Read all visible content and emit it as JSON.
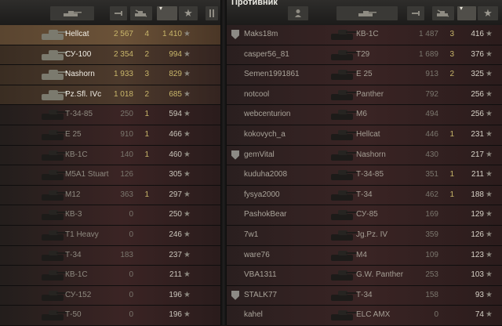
{
  "enemy_title": "Противник",
  "header_icons": [
    "tank-type-icon",
    "xp-icon",
    "kills-icon",
    "sort-icon",
    "star-icon",
    "settings-icon",
    "player-icon"
  ],
  "left_team": [
    {
      "vehicle": "Hellcat",
      "xp": "2 567",
      "kills": "4",
      "damage": "1 410",
      "state": "player"
    },
    {
      "vehicle": "СУ-100",
      "xp": "2 354",
      "kills": "2",
      "damage": "994",
      "state": "alive"
    },
    {
      "vehicle": "Nashorn",
      "xp": "1 933",
      "kills": "3",
      "damage": "829",
      "state": "alive"
    },
    {
      "vehicle": "Pz.Sfl. IVc",
      "xp": "1 018",
      "kills": "2",
      "damage": "685",
      "state": "alive"
    },
    {
      "vehicle": "Т-34-85",
      "xp": "250",
      "kills": "1",
      "damage": "594",
      "state": "dead"
    },
    {
      "vehicle": "E 25",
      "xp": "910",
      "kills": "1",
      "damage": "466",
      "state": "dead"
    },
    {
      "vehicle": "КВ-1С",
      "xp": "140",
      "kills": "1",
      "damage": "460",
      "state": "dead"
    },
    {
      "vehicle": "M5A1 Stuart",
      "xp": "126",
      "kills": "",
      "damage": "305",
      "state": "dead"
    },
    {
      "vehicle": "M12",
      "xp": "363",
      "kills": "1",
      "damage": "297",
      "state": "dead"
    },
    {
      "vehicle": "КВ-3",
      "xp": "0",
      "kills": "",
      "damage": "250",
      "state": "dead"
    },
    {
      "vehicle": "T1 Heavy",
      "xp": "0",
      "kills": "",
      "damage": "246",
      "state": "dead"
    },
    {
      "vehicle": "Т-34",
      "xp": "183",
      "kills": "",
      "damage": "237",
      "state": "dead"
    },
    {
      "vehicle": "КВ-1С",
      "xp": "0",
      "kills": "",
      "damage": "211",
      "state": "dead"
    },
    {
      "vehicle": "СУ-152",
      "xp": "0",
      "kills": "",
      "damage": "196",
      "state": "dead"
    },
    {
      "vehicle": "Т-50",
      "xp": "0",
      "kills": "",
      "damage": "196",
      "state": "dead"
    }
  ],
  "right_team": [
    {
      "player": "Maks18m",
      "clan": true,
      "vehicle": "КВ-1С",
      "xp": "1 487",
      "kills": "3",
      "damage": "416"
    },
    {
      "player": "casper56_81",
      "clan": false,
      "vehicle": "T29",
      "xp": "1 689",
      "kills": "3",
      "damage": "376"
    },
    {
      "player": "Semen1991861",
      "clan": false,
      "vehicle": "E 25",
      "xp": "913",
      "kills": "2",
      "damage": "325"
    },
    {
      "player": "notcool",
      "clan": false,
      "vehicle": "Panther",
      "xp": "792",
      "kills": "",
      "damage": "256"
    },
    {
      "player": "webcenturion",
      "clan": false,
      "vehicle": "M6",
      "xp": "494",
      "kills": "",
      "damage": "256"
    },
    {
      "player": "kokovych_a",
      "clan": false,
      "vehicle": "Hellcat",
      "xp": "446",
      "kills": "1",
      "damage": "231"
    },
    {
      "player": "gemVital",
      "clan": true,
      "vehicle": "Nashorn",
      "xp": "430",
      "kills": "",
      "damage": "217"
    },
    {
      "player": "kuduha2008",
      "clan": false,
      "vehicle": "Т-34-85",
      "xp": "351",
      "kills": "1",
      "damage": "211"
    },
    {
      "player": "fysya2000",
      "clan": false,
      "vehicle": "Т-34",
      "xp": "462",
      "kills": "1",
      "damage": "188"
    },
    {
      "player": "PashokBear",
      "clan": false,
      "vehicle": "СУ-85",
      "xp": "169",
      "kills": "",
      "damage": "129"
    },
    {
      "player": "7w1",
      "clan": false,
      "vehicle": "Jg.Pz. IV",
      "xp": "359",
      "kills": "",
      "damage": "126"
    },
    {
      "player": "ware76",
      "clan": false,
      "vehicle": "M4",
      "xp": "109",
      "kills": "",
      "damage": "123"
    },
    {
      "player": "VBA1311",
      "clan": false,
      "vehicle": "G.W. Panther",
      "xp": "253",
      "kills": "",
      "damage": "103"
    },
    {
      "player": "STALK77",
      "clan": true,
      "vehicle": "Т-34",
      "xp": "158",
      "kills": "",
      "damage": "93"
    },
    {
      "player": "kahel",
      "clan": false,
      "vehicle": "ELC AMX",
      "xp": "0",
      "kills": "",
      "damage": "74"
    }
  ],
  "star_glyph": "★"
}
